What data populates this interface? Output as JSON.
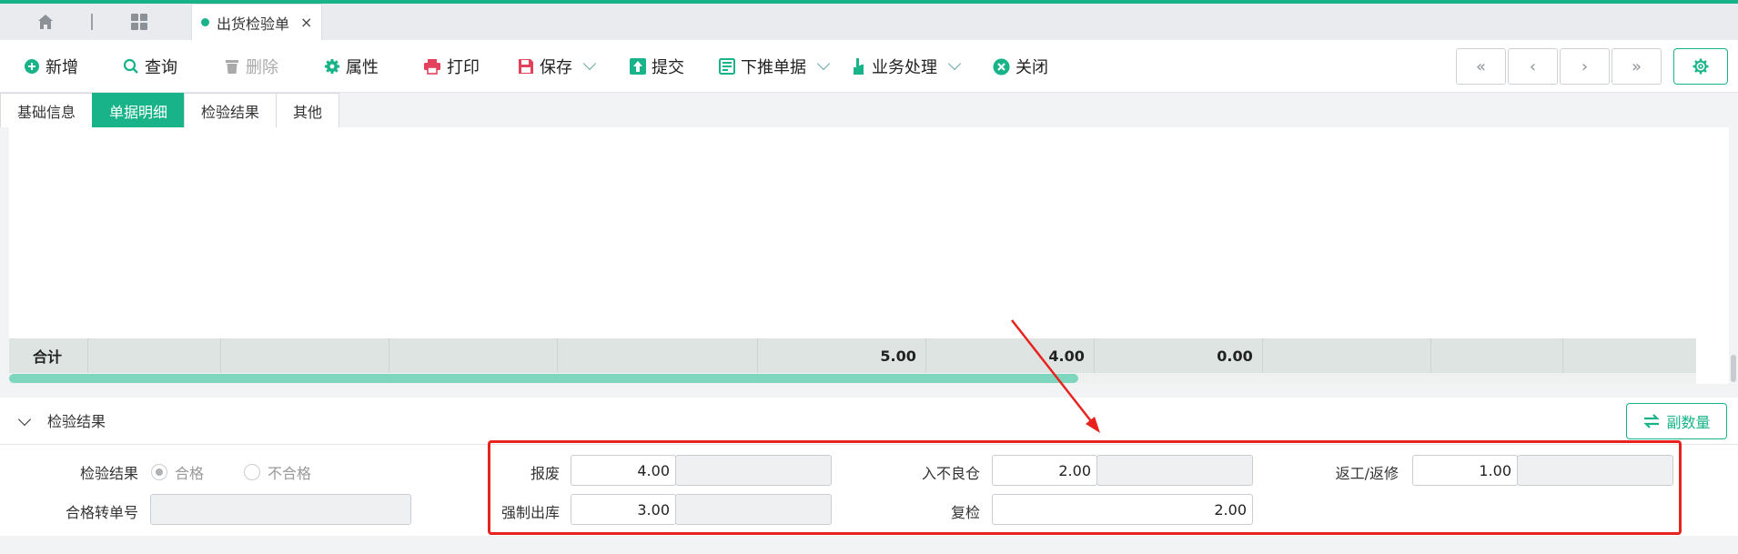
{
  "tabs": {
    "home_icon": "home-icon",
    "apps_icon": "grid-icon",
    "open_tab": {
      "label": "出货检验单",
      "close": "×"
    }
  },
  "toolbar": {
    "add": "新增",
    "query": "查询",
    "delete": "删除",
    "properties": "属性",
    "print": "打印",
    "save": "保存",
    "submit": "提交",
    "push_down": "下推单据",
    "business": "业务处理",
    "close": "关闭",
    "nav": {
      "first": "«",
      "prev": "‹",
      "next": "›",
      "last": "»"
    }
  },
  "subtabs": [
    "基础信息",
    "单据明细",
    "检验结果",
    "其他"
  ],
  "active_subtab": "单据明细",
  "summary": {
    "label": "合计",
    "v1": "5.00",
    "v2": "4.00",
    "v3": "0.00"
  },
  "results": {
    "section_title": "检验结果",
    "dup_button": "副数量",
    "result_label": "检验结果",
    "radio_pass": "合格",
    "radio_fail": "不合格",
    "transfer_label": "合格转单号",
    "transfer_value": "",
    "scrap_label": "报废",
    "scrap_value": "4.00",
    "bad_wh_label": "入不良仓",
    "bad_wh_value": "2.00",
    "rework_label": "返工/返修",
    "rework_value": "1.00",
    "force_out_label": "强制出库",
    "force_out_value": "3.00",
    "recheck_label": "复检",
    "recheck_value": "2.00"
  },
  "colors": {
    "accent": "#19b38a",
    "highlight": "#e8231f"
  }
}
